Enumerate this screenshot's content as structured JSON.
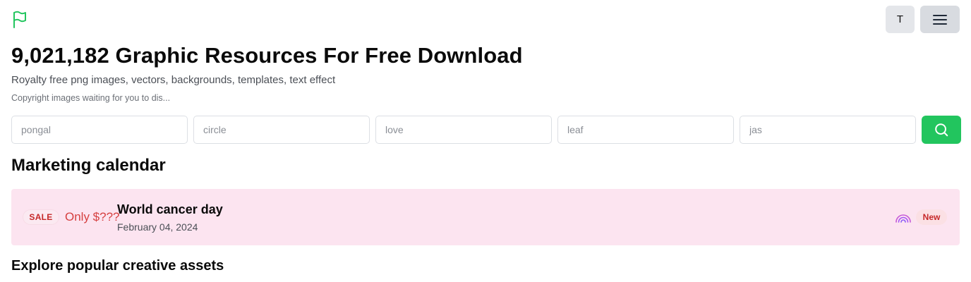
{
  "header": {
    "logo_icon": "flag-icon",
    "user_initial": "T",
    "menu_icon": "hamburger-menu-icon",
    "accent_color": "#22c55e"
  },
  "hero": {
    "title": "9,021,182 Graphic Resources For Free Download",
    "subtitle": "Royalty free png images, vectors, backgrounds, templates, text effect",
    "note": "Copyright images waiting for you to dis..."
  },
  "search": {
    "fields": [
      {
        "placeholder": "pongal"
      },
      {
        "placeholder": "circle"
      },
      {
        "placeholder": "love"
      },
      {
        "placeholder": "leaf"
      },
      {
        "placeholder": "jas"
      }
    ],
    "button_icon": "search-icon"
  },
  "marketing": {
    "title": "Marketing calendar",
    "event": {
      "sale_badge": "SALE",
      "price": "Only $???",
      "name": "World cancer day",
      "date": "February 04, 2024",
      "decor_icon": "rainbow-icon",
      "new_badge": "New",
      "background_color": "#fce4f0"
    }
  },
  "explore": {
    "title": "Explore popular creative assets"
  }
}
